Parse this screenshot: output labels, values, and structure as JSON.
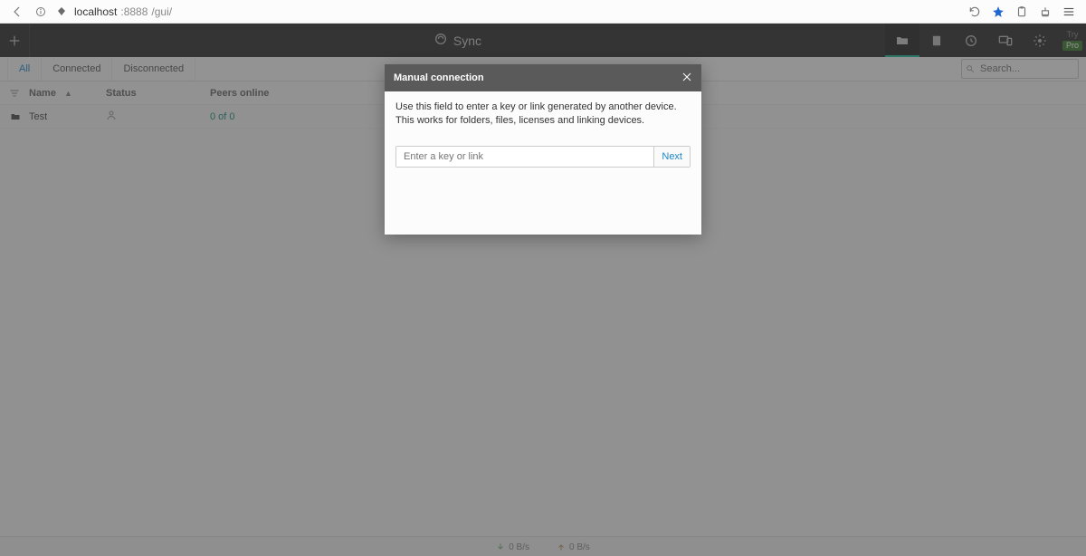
{
  "browser": {
    "url_host": "localhost",
    "url_port": ":8888",
    "url_path": "/gui/"
  },
  "app": {
    "brand": "Sync",
    "try_label": "Try",
    "pro_label": "Pro"
  },
  "subnav": {
    "tabs": [
      "All",
      "Connected",
      "Disconnected"
    ],
    "active_index": 0,
    "search_placeholder": "Search..."
  },
  "table": {
    "headers": {
      "name": "Name",
      "status": "Status",
      "peers": "Peers online"
    },
    "rows": [
      {
        "name": "Test",
        "status_icon": "user-icon",
        "peers": "0 of 0"
      }
    ]
  },
  "status_bar": {
    "download": "0 B/s",
    "upload": "0 B/s"
  },
  "modal": {
    "title": "Manual connection",
    "description": "Use this field to enter a key or link generated by another device. This works for folders, files, licenses and linking devices.",
    "input_placeholder": "Enter a key or link",
    "next_label": "Next"
  }
}
